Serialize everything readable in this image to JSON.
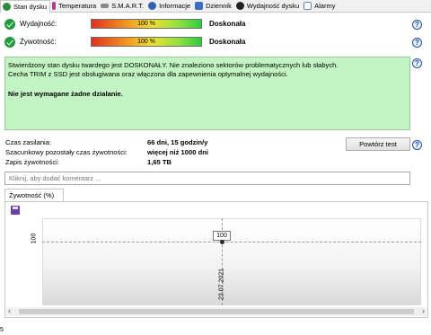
{
  "tabs": [
    {
      "label": "Stan dysku",
      "icon": "disk-health-icon",
      "color": "#2e8b3a"
    },
    {
      "label": "Temperatura",
      "icon": "thermometer-icon",
      "color": "#b03a8c"
    },
    {
      "label": "S.M.A.R.T.",
      "icon": "smart-icon",
      "color": "#777777"
    },
    {
      "label": "Informacje",
      "icon": "info-icon",
      "color": "#2d62b8"
    },
    {
      "label": "Dziennik",
      "icon": "log-icon",
      "color": "#3a6fc4"
    },
    {
      "label": "Wydajność dysku",
      "icon": "performance-icon",
      "color": "#222222"
    },
    {
      "label": "Alarmy",
      "icon": "alarm-icon",
      "color": "#6a88c0"
    }
  ],
  "performance": {
    "label": "Wydajność:",
    "value": 100,
    "bar_text": "100 %",
    "status": "Doskonała"
  },
  "health": {
    "label": "Żywotność:",
    "value": 100,
    "bar_text": "100 %",
    "status": "Doskonała"
  },
  "message": {
    "line1": "Stwierdzony stan dysku twardego jest DOSKONAŁY. Nie znaleziono sektorów problematycznych lub słabych.",
    "line2": "Cecha TRIM z SSD jest obsługiwana oraz włączona dla zapewnienia optymalnej wydajności.",
    "action": "Nie jest wymagane żadne działanie."
  },
  "info": {
    "power_on_label": "Czas zasilania:",
    "power_on_value": "66 dni, 15 godzin/y",
    "remaining_label": "Szacunkowy pozostały czas żywotności:",
    "remaining_value": "więcej niż 1000 dni",
    "written_label": "Zapis żywotności:",
    "written_value": "1,65 TB"
  },
  "retest_button": "Powtórz test",
  "comment": {
    "placeholder": "Kliknij, aby dodać komentarz ..."
  },
  "chart_tab": "Żywotność (%)",
  "chart_data": {
    "type": "line",
    "title": "",
    "x": [
      "23.07.2021"
    ],
    "series": [
      {
        "values": [
          100
        ]
      }
    ],
    "data_labels": [
      "100"
    ],
    "yticks": [
      "100"
    ],
    "xticks": [
      "23.07.2021"
    ],
    "grid": true
  },
  "stray_char": "5"
}
